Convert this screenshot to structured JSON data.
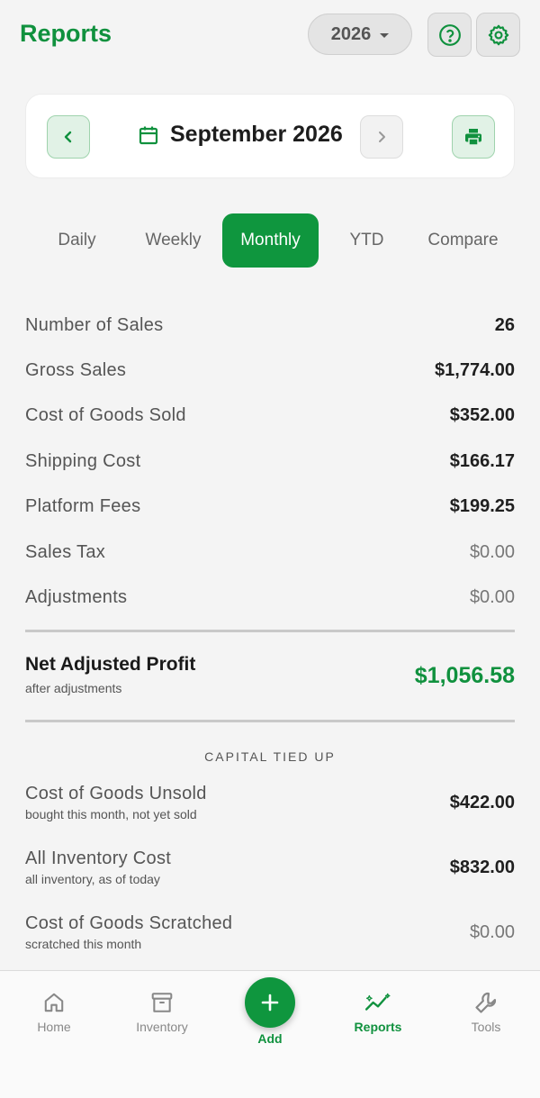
{
  "header": {
    "title": "Reports",
    "year": "2026",
    "help_icon": "help-circle-icon",
    "settings_icon": "gear-icon"
  },
  "month_nav": {
    "label": "September 2026",
    "prev_icon": "chevron-left-icon",
    "next_icon": "chevron-right-icon",
    "calendar_icon": "calendar-icon",
    "print_icon": "printer-icon"
  },
  "tabs": [
    {
      "label": "Daily"
    },
    {
      "label": "Weekly"
    },
    {
      "label": "Monthly",
      "active": true
    },
    {
      "label": "YTD"
    },
    {
      "label": "Compare"
    }
  ],
  "summary": [
    {
      "label": "Number of Sales",
      "value": "26"
    },
    {
      "label": "Gross Sales",
      "value": "$1,774.00"
    },
    {
      "label": "Cost of Goods Sold",
      "value": "$352.00"
    },
    {
      "label": "Shipping Cost",
      "value": "$166.17"
    },
    {
      "label": "Platform Fees",
      "value": "$199.25"
    },
    {
      "label": "Sales Tax",
      "value": "$0.00"
    },
    {
      "label": "Adjustments",
      "value": "$0.00"
    }
  ],
  "net": {
    "title": "Net Adjusted Profit",
    "subtitle": "after adjustments",
    "value": "$1,056.58"
  },
  "capital": {
    "section_title": "CAPITAL TIED UP",
    "rows": [
      {
        "label": "Cost of Goods Unsold",
        "sub": "bought this month, not yet sold",
        "value": "$422.00"
      },
      {
        "label": "All Inventory Cost",
        "sub": "all inventory, as of today",
        "value": "$832.00"
      },
      {
        "label": "Cost of Goods Scratched",
        "sub": "scratched this month",
        "value": "$0.00"
      }
    ]
  },
  "bottom_nav": {
    "items": [
      {
        "label": "Home",
        "icon": "home-icon"
      },
      {
        "label": "Inventory",
        "icon": "archive-box-icon"
      },
      {
        "label": "Add",
        "icon": "plus-icon"
      },
      {
        "label": "Reports",
        "icon": "trending-sparkle-icon",
        "active": true
      },
      {
        "label": "Tools",
        "icon": "wrench-icon"
      }
    ]
  },
  "colors": {
    "accent": "#10913e",
    "background": "#f4f4f4"
  }
}
